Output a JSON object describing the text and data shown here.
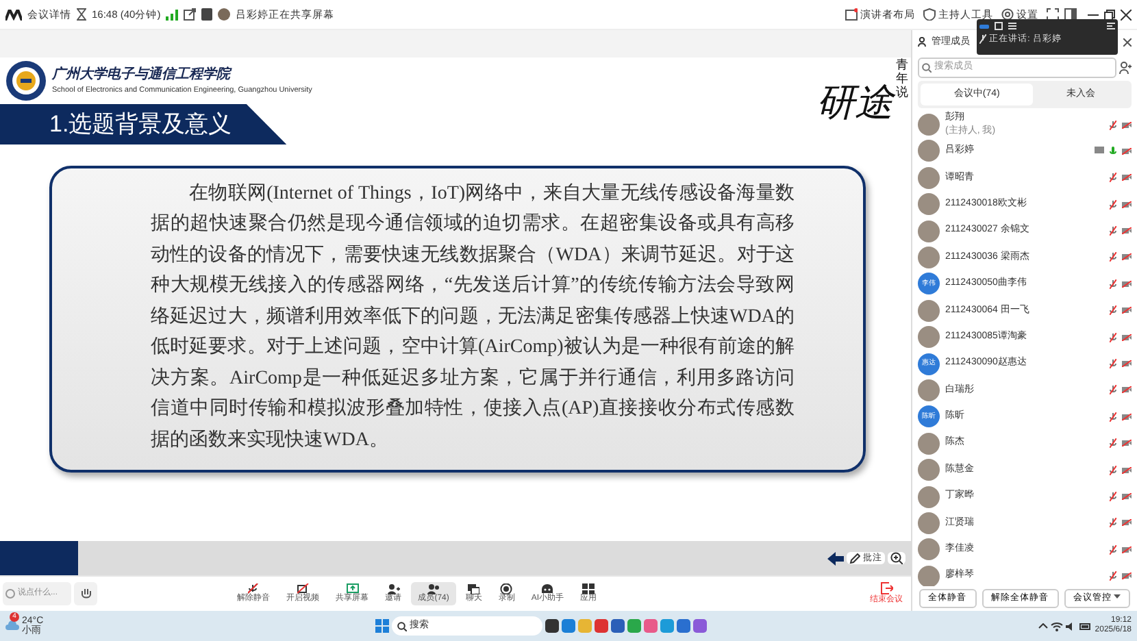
{
  "top_bar": {
    "meeting_info": "会议详情",
    "duration": "16:48 (40分钟)",
    "sharing_notice": "吕彩婷正在共享屏幕",
    "actions": [
      {
        "label": "演讲者布局"
      },
      {
        "label": "主持人工具"
      },
      {
        "label": "设置"
      }
    ]
  },
  "speaker_window": {
    "label": "正在讲话:",
    "speaker": "吕彩婷"
  },
  "slide": {
    "school": "广州大学电子与通信工程学院",
    "school_en": "School of Electronics and Communication Engineering, Guangzhou University",
    "title": "1.选题背景及意义",
    "brand": "研途",
    "brand_sub": "青年说",
    "body": "在物联网(Internet of Things，IoT)网络中，来自大量无线传感设备海量数据的超快速聚合仍然是现今通信领域的迫切需求。在超密集设备或具有高移动性的设备的情况下，需要快速无线数据聚合（WDA）来调节延迟。对于这种大规模无线接入的传感器网络，“先发送后计算”的传统传输方法会导致网络延迟过大，频谱利用效率低下的问题，无法满足密集传感器上快速WDA的低时延要求。对于上述问题，空中计算(AirComp)被认为是一种很有前途的解决方案。AirComp是一种低延迟多址方案，它属于并行通信，利用多路访问信道中同时传输和模拟波形叠加特性，使接入点(AP)直接接收分布式传感数据的函数来实现快速WDA。",
    "annotate": "批注"
  },
  "toolbar": {
    "chat_placeholder": "说点什么...",
    "items": [
      {
        "label": "解除静音",
        "selected": false
      },
      {
        "label": "开启视频",
        "selected": false
      },
      {
        "label": "共享屏幕",
        "selected": false
      },
      {
        "label": "邀请",
        "selected": false
      },
      {
        "label": "成员(74)",
        "selected": true
      },
      {
        "label": "聊天",
        "selected": false
      },
      {
        "label": "录制",
        "selected": false
      },
      {
        "label": "AI小助手",
        "selected": false
      },
      {
        "label": "应用",
        "selected": false
      }
    ],
    "end": "结束会议"
  },
  "members_panel": {
    "title": "管理成员",
    "search_placeholder": "搜索成员",
    "tabs": [
      {
        "label": "会议中(74)",
        "selected": true
      },
      {
        "label": "未入会",
        "selected": false
      }
    ],
    "members": [
      {
        "name": "彭翔",
        "role": "(主持人, 我)",
        "kind": "photo",
        "muted": true,
        "sharing": false
      },
      {
        "name": "吕彩婷",
        "kind": "photo",
        "muted": false,
        "sharing": true
      },
      {
        "name": "谭昭青",
        "kind": "photo",
        "muted": true,
        "sharing": false
      },
      {
        "name": "2112430018欧文彬",
        "kind": "photo",
        "muted": true,
        "sharing": false
      },
      {
        "name": "2112430027 余锦文",
        "kind": "photo",
        "muted": true,
        "sharing": false
      },
      {
        "name": "2112430036 梁雨杰",
        "kind": "photo",
        "muted": true,
        "sharing": false
      },
      {
        "name": "2112430050曲李伟",
        "kind": "initials",
        "initials": "李伟",
        "muted": true,
        "sharing": false
      },
      {
        "name": "2112430064 田一飞",
        "kind": "photo",
        "muted": true,
        "sharing": false
      },
      {
        "name": "2112430085谭淘豪",
        "kind": "photo",
        "muted": true,
        "sharing": false
      },
      {
        "name": "2112430090赵惠达",
        "kind": "initials",
        "initials": "惠达",
        "muted": true,
        "sharing": false
      },
      {
        "name": "白瑞彤",
        "kind": "photo",
        "muted": true,
        "sharing": false
      },
      {
        "name": "陈昕",
        "kind": "initials",
        "initials": "陈昕",
        "muted": true,
        "sharing": false
      },
      {
        "name": "陈杰",
        "kind": "photo",
        "muted": true,
        "sharing": false
      },
      {
        "name": "陈慧金",
        "kind": "photo",
        "muted": true,
        "sharing": false
      },
      {
        "name": "丁家晔",
        "kind": "photo",
        "muted": true,
        "sharing": false
      },
      {
        "name": "江贤瑞",
        "kind": "photo",
        "muted": true,
        "sharing": false
      },
      {
        "name": "李佳凌",
        "kind": "photo",
        "muted": true,
        "sharing": false
      },
      {
        "name": "廖梓琴",
        "kind": "photo",
        "muted": true,
        "sharing": false
      }
    ],
    "buttons": [
      {
        "label": "全体静音",
        "kind": "plain"
      },
      {
        "label": "解除全体静音",
        "kind": "plain"
      },
      {
        "label": "会议管控",
        "kind": "dropdown"
      }
    ]
  },
  "taskbar": {
    "weather_temp": "24°C",
    "weather_text": "小雨",
    "weather_badge": "4",
    "search": "搜索",
    "time": "19:12",
    "date": "2025/6/18"
  }
}
